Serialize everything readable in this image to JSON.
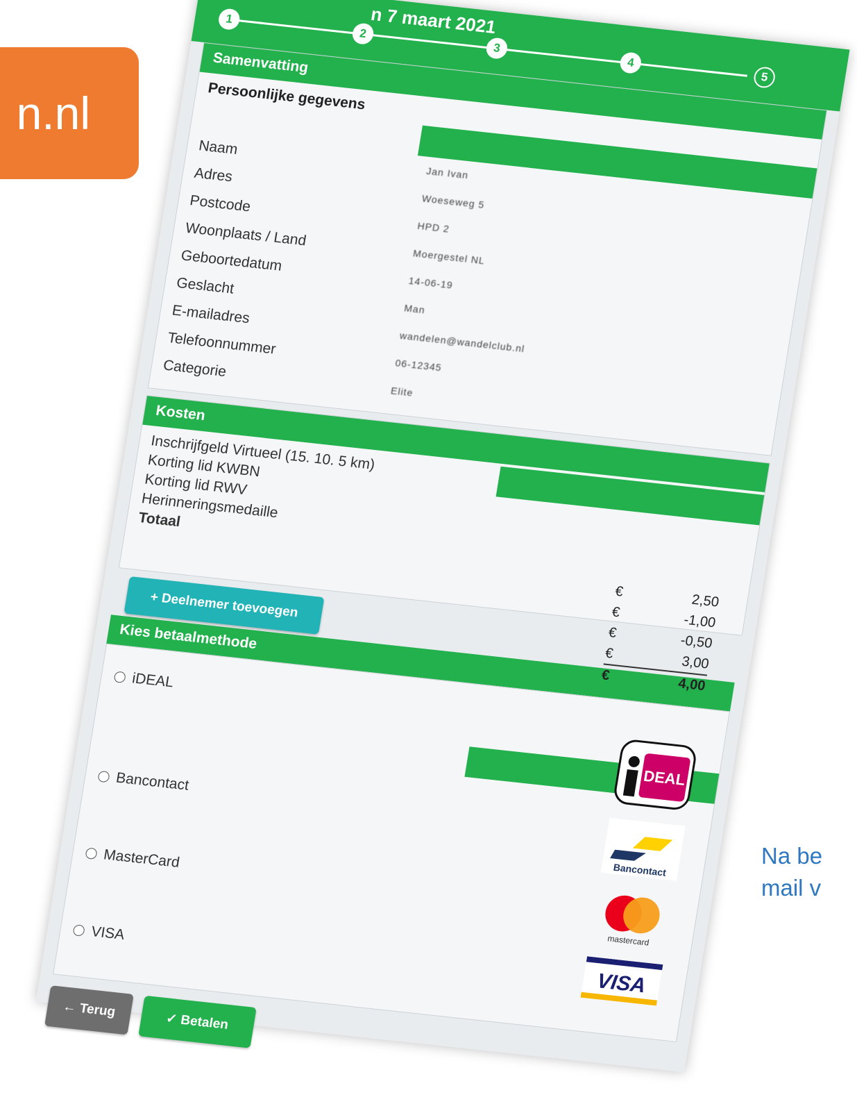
{
  "badge": {
    "text": "n.nl"
  },
  "caption": {
    "line1": "Na be",
    "line2": "mail v"
  },
  "header": {
    "date": "n 7 maart 2021",
    "steps": [
      "1",
      "2",
      "3",
      "4",
      "5"
    ]
  },
  "summary": {
    "title": "Samenvatting",
    "personal_title": "Persoonlijke gegevens",
    "fields": [
      {
        "label": "Naam",
        "value": "Jan Ivan"
      },
      {
        "label": "Adres",
        "value": "Woeseweg 5"
      },
      {
        "label": "Postcode",
        "value": "HPD 2"
      },
      {
        "label": "Woonplaats / Land",
        "value": "Moergestel NL"
      },
      {
        "label": "Geboortedatum",
        "value": "14-06-19"
      },
      {
        "label": "Geslacht",
        "value": "Man"
      },
      {
        "label": "E-mailadres",
        "value": "wandelen@wandelclub.nl"
      },
      {
        "label": "Telefoonnummer",
        "value": "06-12345"
      },
      {
        "label": "Categorie",
        "value": "Elite"
      }
    ]
  },
  "costs": {
    "title": "Kosten",
    "lines": [
      "Inschrijfgeld Virtueel (15. 10. 5 km)",
      "Korting lid KWBN",
      "Korting lid RWV",
      "Herinneringsmedaille"
    ],
    "total_label": "Totaal",
    "currency": "€",
    "amounts": [
      "2,50",
      "-1,00",
      "-0,50",
      "3,00"
    ],
    "total": "4,00"
  },
  "add_participant": {
    "label": "+ Deelnemer toevoegen"
  },
  "payment": {
    "title": "Kies betaalmethode",
    "options": [
      "iDEAL",
      "Bancontact",
      "MasterCard",
      "VISA"
    ],
    "logos": {
      "ideal": "DEAL",
      "bancontact": "Bancontact",
      "mastercard": "mastercard",
      "visa": "VISA"
    }
  },
  "buttons": {
    "back": "← Terug",
    "pay": "✓ Betalen"
  },
  "colors": {
    "primary_green": "#22b14c",
    "teal_button": "#22b3b7",
    "orange_badge": "#ee7b2f",
    "caption_blue": "#2f78c0"
  }
}
